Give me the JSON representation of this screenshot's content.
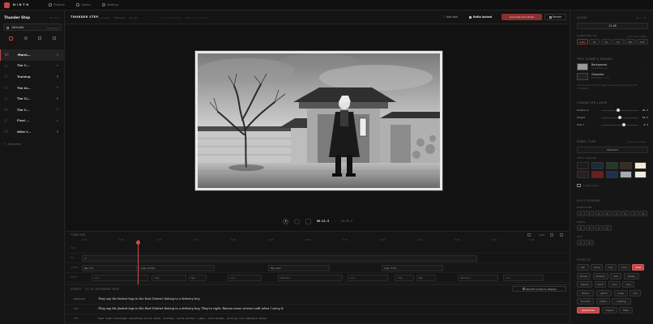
{
  "app": {
    "logo_text": "NINTH",
    "nav": [
      "Projects",
      "Library",
      "Settings"
    ]
  },
  "colors": {
    "accent": "#c44545",
    "bg": "#141414",
    "panel": "#181818"
  },
  "sidebar": {
    "project_title": "Thunder Step",
    "project_meta": "01:33.5",
    "resolution": "1024×464",
    "res_meta": "landscape",
    "scenes": [
      {
        "num": "01",
        "title": "Morni..."
      },
      {
        "num": "02",
        "title": "The C..."
      },
      {
        "num": "03",
        "title": "Training"
      },
      {
        "num": "04",
        "title": "The Ar..."
      },
      {
        "num": "05",
        "title": "The Cl..."
      },
      {
        "num": "06",
        "title": "The C..."
      },
      {
        "num": "07",
        "title": "Final ..."
      },
      {
        "num": "08",
        "title": "After t..."
      }
    ],
    "add_scene": "Add scene"
  },
  "header": {
    "scene_title": "THUNDER STEP",
    "scene_meta": "8 scenes · 1024×464 · 24 fps",
    "hint": "click to preview · dblclick to edit",
    "add_text": "Add text",
    "ratio_locked": "Ratio locked",
    "regenerate": "Generate thumbnail",
    "render": "Render"
  },
  "playback": {
    "current": "00:11.5",
    "total": "01:33.5"
  },
  "timeline": {
    "label": "TIMELINE",
    "zoom_label": "100%",
    "ticks": [
      "0:00",
      "0:05",
      "0:10",
      "0:15",
      "0:20",
      "0:25",
      "0:30",
      "0:35",
      "0:40",
      "0:45",
      "0:50",
      "0:55",
      "1:00"
    ],
    "rows": [
      {
        "name": "0:00",
        "clips": []
      },
      {
        "name": "CUT",
        "clips": [
          {
            "label": "01"
          }
        ]
      },
      {
        "name": "LAYERS",
        "clips": [
          {
            "label": "bg1_run"
          },
          {
            "label": "sign_street"
          },
          {
            "label": "bg1_walk"
          },
          {
            "label": "sign_front"
          }
        ]
      },
      {
        "name": "AUDIO",
        "clips": [
          {
            "label": "suhk"
          },
          {
            "label": "ring"
          },
          {
            "label": "bg1"
          },
          {
            "label": "suhk"
          },
          {
            "label": "ambience"
          },
          {
            "label": "suhk"
          },
          {
            "label": "ring"
          },
          {
            "label": "bg1"
          },
          {
            "label": "ambience"
          },
          {
            "label": "suhk"
          }
        ]
      }
    ]
  },
  "script": {
    "label": "SCRIPT · 01 01 MORNING RUN",
    "rebuild": "Rebuild scripts & staging",
    "lines": [
      {
        "speaker": "NARRATOR",
        "text": "They say the fastest legs in the East District belong to a delivery boy.",
        "style": "normal"
      },
      {
        "speaker": "KAI",
        "text": "They say the fastest legs in the East District belong to a delivery boy. They're right. Ramen never arrives cold when I carry it.",
        "style": "italic"
      },
      {
        "speaker": "SFX",
        "text": "Fast light footsteps splashing across metal rooftops, quick parkour jumps, wind whoosh, morning city ambience below",
        "style": "mono"
      }
    ]
  },
  "right_panel": {
    "scene_label": "SCENE",
    "scene_meta": "01 · 01",
    "duration": "11.65",
    "duration_label": "DURATION (S)",
    "duration_hint": "from audio length",
    "presets": [
      "auto",
      "3s",
      "5s",
      "8s",
      "10s",
      "15s"
    ],
    "layers_label": "THIS SCENE'S IMAGES",
    "layers": [
      {
        "name": "Background",
        "meta": "1024×464 · bg"
      },
      {
        "name": "Character",
        "meta": "1024×464 · char"
      }
    ],
    "layers_note": "Use the layer for the image. Remove the background to composite.",
    "char_label": "CHARACTER LAYER",
    "sliders": [
      {
        "name": "Position X",
        "value": "24.3",
        "fraction": 0.45
      },
      {
        "name": "Height",
        "value": "54.3",
        "fraction": 0.5
      },
      {
        "name": "Feet Y",
        "value": "8.3",
        "fraction": 0.6
      }
    ],
    "panel_type_label": "PANEL TYPE",
    "panel_type_hint": "by scene number",
    "panel_type_value": "Standard",
    "text_colors_label": "TEXT COLORS",
    "swatches": [
      "#1b1b1b",
      "#1e2a3a",
      "#1f3a2a",
      "#3b2b1f",
      "#f2ead2",
      "#2b1e1e",
      "#6d1e1e",
      "#1f2f4f",
      "#a9a9b1",
      "#f0ecdf"
    ],
    "custom_label": "custom colour",
    "split_label": "SPLIT SCREEN",
    "split_sub1": "DIRECTION",
    "split_row1": [
      "1",
      "2",
      "3",
      "4",
      "5",
      "6",
      "7",
      "8"
    ],
    "split_sub2": "PARTS",
    "split_row2": [
      "1",
      "2",
      "3",
      "4"
    ],
    "split_sub3": "GAP",
    "split_row3": [
      "1",
      "2"
    ],
    "effects_label": "EFFECTS",
    "effects": [
      {
        "label": "rain",
        "active": false
      },
      {
        "label": "snow",
        "active": false
      },
      {
        "label": "fog",
        "active": false
      },
      {
        "label": "dust",
        "active": false
      },
      {
        "label": "heat",
        "active": true
      },
      {
        "label": "smoke",
        "active": false
      },
      {
        "label": "embers",
        "active": false
      },
      {
        "label": "ash",
        "active": false
      },
      {
        "label": "petals",
        "active": false
      },
      {
        "label": "leaves",
        "active": false
      },
      {
        "label": "neon",
        "active": false
      },
      {
        "label": "lens",
        "active": false
      },
      {
        "label": "rays",
        "active": false
      },
      {
        "label": "flicker",
        "active": false
      },
      {
        "label": "glitch",
        "active": false
      },
      {
        "label": "pulse",
        "active": false
      },
      {
        "label": "vhs",
        "active": false
      },
      {
        "label": "thunder",
        "active": false
      },
      {
        "label": "shake",
        "active": false
      },
      {
        "label": "lighting",
        "active": false
      },
      {
        "label": "speedlines",
        "active": true
      },
      {
        "label": "impact",
        "active": false
      },
      {
        "label": "flash",
        "active": false
      }
    ]
  }
}
